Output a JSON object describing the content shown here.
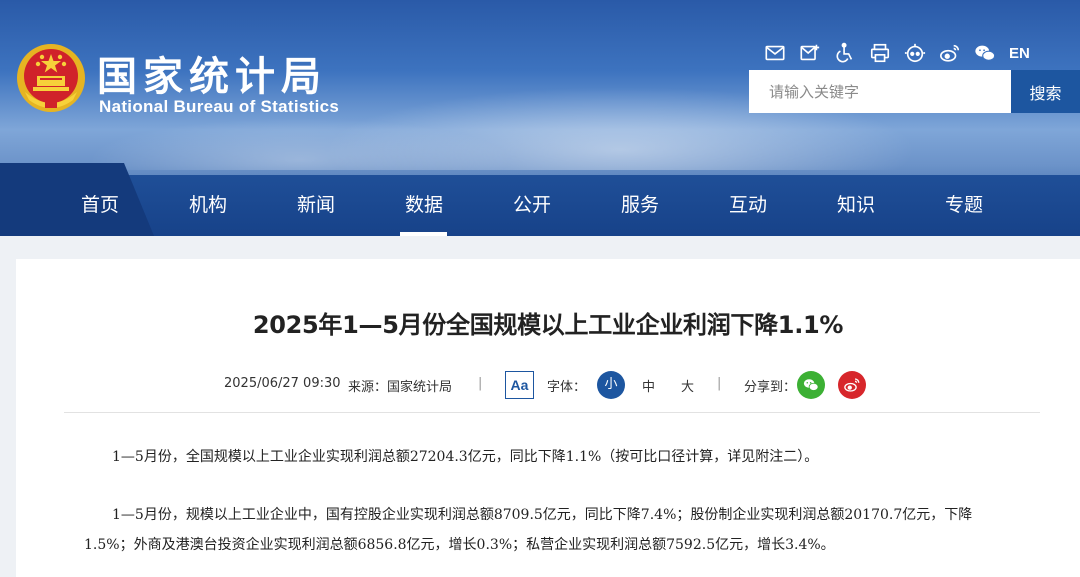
{
  "header": {
    "site_name_cn": "国家统计局",
    "site_name_en": "National Bureau of Statistics",
    "tools": [
      {
        "icon": "mail-icon"
      },
      {
        "icon": "message-icon"
      },
      {
        "icon": "accessibility-icon"
      },
      {
        "icon": "print-icon"
      },
      {
        "icon": "robot-icon"
      },
      {
        "icon": "weibo-icon"
      },
      {
        "icon": "wechat-icon"
      }
    ],
    "lang_label": "EN",
    "search_placeholder": "请输入关键字",
    "search_button": "搜索"
  },
  "nav": {
    "items": [
      "首页",
      "机构",
      "新闻",
      "数据",
      "公开",
      "服务",
      "互动",
      "知识",
      "专题"
    ],
    "active_index": 3
  },
  "article": {
    "title": "2025年1—5月份全国规模以上工业企业利润下降1.1%",
    "date": "2025/06/27 09:30",
    "source": "来源：国家统计局",
    "font_size_label": "字体：",
    "font_sizes": [
      "小",
      "中",
      "大"
    ],
    "font_size_toggle": "Aa",
    "share_label": "分享到：",
    "separator": "|",
    "paragraphs": [
      "1—5月份，全国规模以上工业企业实现利润总额27204.3亿元，同比下降1.1%（按可比口径计算，详见附注二）。",
      "1—5月份，规模以上工业企业中，国有控股企业实现利润总额8709.5亿元，同比下降7.4%；股份制企业实现利润总额20170.7亿元，下降1.5%；外商及港澳台投资企业实现利润总额6856.8亿元，增长0.3%；私营企业实现利润总额7592.5亿元，增长3.4%。"
    ]
  },
  "colors": {
    "brand_blue": "#1d56a0",
    "nav_blue": "#1f4f98",
    "wechat_green": "#3cb034",
    "weibo_red": "#d7262b"
  }
}
